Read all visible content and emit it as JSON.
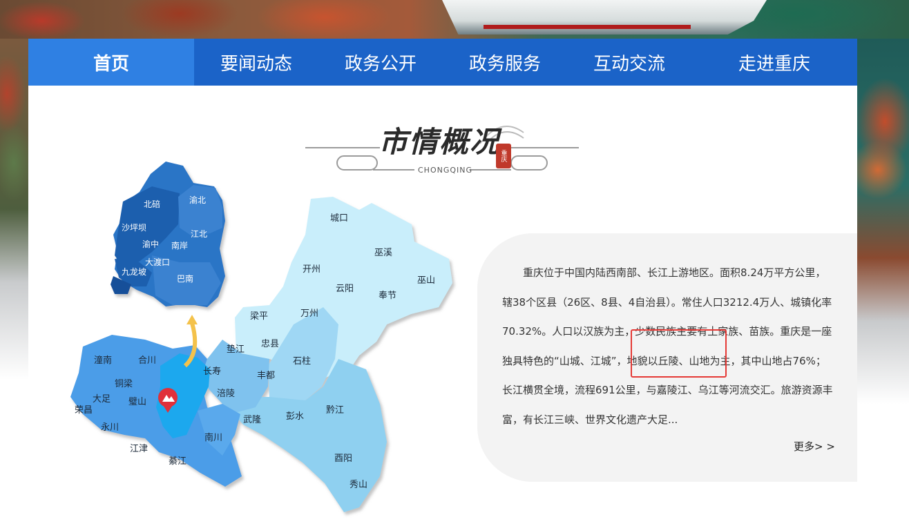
{
  "nav": {
    "items": [
      "首页",
      "要闻动态",
      "政务公开",
      "政务服务",
      "互动交流",
      "走进重庆"
    ],
    "active_index": 0
  },
  "section": {
    "title": "市情概况",
    "subtitle": "CHONGQING",
    "seal_text": "重庆"
  },
  "map": {
    "inset_labels": [
      "北碚",
      "渝北",
      "沙坪坝",
      "江北",
      "渝中",
      "南岸",
      "大渡口",
      "九龙坡",
      "巴南"
    ],
    "labels": [
      "城口",
      "巫溪",
      "开州",
      "云阳",
      "巫山",
      "奉节",
      "梁平",
      "万州",
      "垫江",
      "忠县",
      "潼南",
      "合川",
      "长寿",
      "丰都",
      "石柱",
      "铜梁",
      "大足",
      "璧山",
      "涪陵",
      "荣昌",
      "永川",
      "武隆",
      "彭水",
      "黔江",
      "南川",
      "江津",
      "綦江",
      "酉阳",
      "秀山"
    ]
  },
  "info": {
    "text": "重庆位于中国内陆西南部、长江上游地区。面积8.24万平方公里，辖38个区县（26区、8县、4自治县）。常住人口3212.4万人、城镇化率70.32%。人口以汉族为主，少数民族主要有土家族、苗族。重庆是一座独具特色的“山城、江城”，地貌以丘陵、山地为主，其中山地占76%；长江横贯全境，流程691公里，与嘉陵江、乌江等河流交汇。旅游资源丰富，有长江三峡、世界文化遗产大足...",
    "more_label": "更多> >"
  },
  "colors": {
    "nav_bg": "#1b63c8",
    "nav_active": "#2f80e3",
    "card_bg": "#f3f3f3",
    "highlight": "#e53935"
  }
}
